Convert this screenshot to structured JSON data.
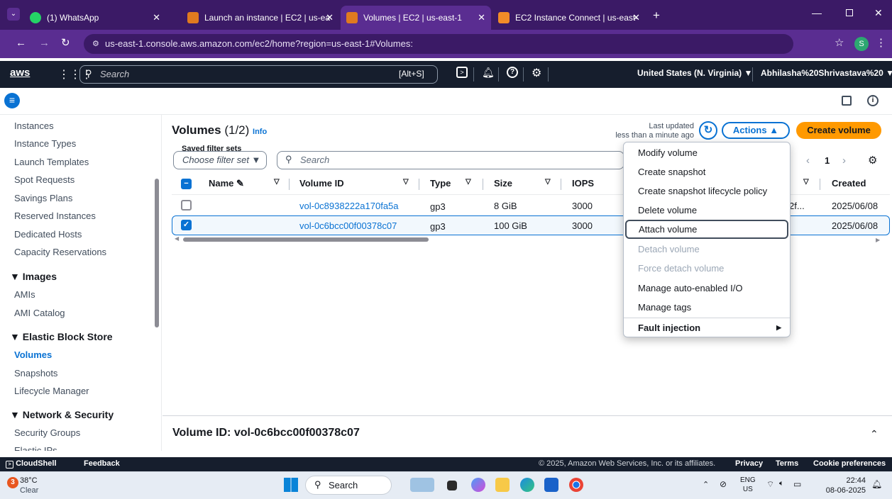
{
  "browser": {
    "tabs": [
      {
        "label": "(1) WhatsApp"
      },
      {
        "label": "Launch an instance | EC2 | us-ea"
      },
      {
        "label": "Volumes | EC2 | us-east-1"
      },
      {
        "label": "EC2 Instance Connect | us-east-"
      }
    ],
    "url": "us-east-1.console.aws.amazon.com/ec2/home?region=us-east-1#Volumes:",
    "profile_initial": "S"
  },
  "aws_header": {
    "logo": "aws",
    "search_placeholder": "Search",
    "search_shortcut": "[Alt+S]",
    "region": "United States (N. Virginia) ▼",
    "account": "Abhilasha%20Shrivastava%20 ▼"
  },
  "sidebar": {
    "items_top": [
      "Instances",
      "Instance Types",
      "Launch Templates",
      "Spot Requests",
      "Savings Plans",
      "Reserved Instances",
      "Dedicated Hosts",
      "Capacity Reservations"
    ],
    "images_head": "▼ Images",
    "images_items": [
      "AMIs",
      "AMI Catalog"
    ],
    "ebs_head": "▼ Elastic Block Store",
    "ebs_items": [
      "Volumes",
      "Snapshots",
      "Lifecycle Manager"
    ],
    "net_head": "▼ Network & Security",
    "net_items": [
      "Security Groups",
      "Elastic IPs"
    ]
  },
  "volumes": {
    "title": "Volumes",
    "count": "(1/2)",
    "info": "Info",
    "last_updated_1": "Last updated",
    "last_updated_2": "less than a minute ago",
    "actions_label": "Actions ▲",
    "create_label": "Create volume",
    "saved_filter_label": "Saved filter sets",
    "filter_select": "Choose filter set ▼",
    "search_placeholder": "Search",
    "page": "1",
    "columns": [
      "Name",
      "Volume ID",
      "Type",
      "Size",
      "IOPS",
      "Created"
    ],
    "rows": [
      {
        "id": "vol-0c8938222a170fa5a",
        "type": "gp3",
        "size": "8 GiB",
        "iops": "3000",
        "extra": "2f...",
        "created": "2025/06/08"
      },
      {
        "id": "vol-0c6bcc00f00378c07",
        "type": "gp3",
        "size": "100 GiB",
        "iops": "3000",
        "extra": "",
        "created": "2025/06/08"
      }
    ],
    "detail_title": "Volume ID: vol-0c6bcc00f00378c07"
  },
  "actions_menu": {
    "items": [
      "Modify volume",
      "Create snapshot",
      "Create snapshot lifecycle policy",
      "Delete volume",
      "Attach volume",
      "Detach volume",
      "Force detach volume",
      "Manage auto-enabled I/O",
      "Manage tags"
    ],
    "fault": "Fault injection"
  },
  "footer": {
    "cloudshell": "CloudShell",
    "feedback": "Feedback",
    "copyright": "© 2025, Amazon Web Services, Inc. or its affiliates.",
    "privacy": "Privacy",
    "terms": "Terms",
    "cookies": "Cookie preferences"
  },
  "taskbar": {
    "weather_badge": "3",
    "temp": "38°C",
    "cond": "Clear",
    "search": "Search",
    "lang1": "ENG",
    "lang2": "US",
    "time": "22:44",
    "date": "08-06-2025"
  },
  "colors": {
    "accent": "#0972d3",
    "create_btn": "#ff9900",
    "aws_nav": "#161e2d",
    "chrome": "#3b1a66"
  }
}
